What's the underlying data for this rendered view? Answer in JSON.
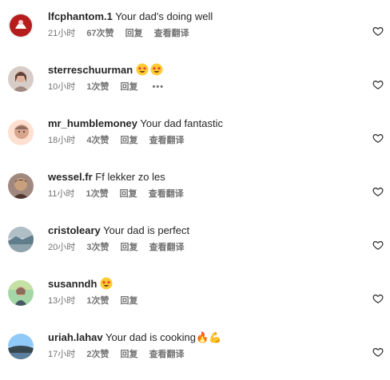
{
  "comments": [
    {
      "username": "lfcphantom.1",
      "text": "Your dad's doing well",
      "time": "21小时",
      "likes": "67次赞",
      "reply": "回复",
      "translate": "查看翻译",
      "avatar_color": "#b71c1c"
    },
    {
      "username": "sterreschuurman",
      "text": "🤩🤩",
      "time": "10小时",
      "likes": "1次赞",
      "reply": "回复",
      "more": "•••",
      "avatar_color": "#a67c6d"
    },
    {
      "username": "mr_humblemoney",
      "text": "Your dad fantastic",
      "time": "18小时",
      "likes": "4次赞",
      "reply": "回复",
      "translate": "查看翻译",
      "avatar_color": "#d7a58c"
    },
    {
      "username": "wessel.fr",
      "text": "Ff lekker zo les",
      "time": "11小时",
      "likes": "1次赞",
      "reply": "回复",
      "translate": "查看翻译",
      "avatar_color": "#8d6e63"
    },
    {
      "username": "cristoleary",
      "text": "Your dad is perfect",
      "time": "20小时",
      "likes": "3次赞",
      "reply": "回复",
      "translate": "查看翻译",
      "avatar_color": "#90a4ae"
    },
    {
      "username": "susanndh",
      "text": "🤩",
      "time": "13小时",
      "likes": "1次赞",
      "reply": "回复",
      "avatar_color": "#6d8b74"
    },
    {
      "username": "uriah.lahav",
      "text": "Your dad is cooking🔥💪",
      "time": "17小时",
      "likes": "2次赞",
      "reply": "回复",
      "translate": "查看翻译",
      "avatar_color": "#5c7f9e"
    }
  ],
  "icons": {
    "like": "heart-outline-icon",
    "emoji_star_eyes": "star-struck-emoji",
    "emoji_fire": "fire-emoji",
    "emoji_muscle": "flexed-biceps-emoji"
  },
  "colors": {
    "username": "#262626",
    "meta": "#737373",
    "background": "#ffffff"
  }
}
